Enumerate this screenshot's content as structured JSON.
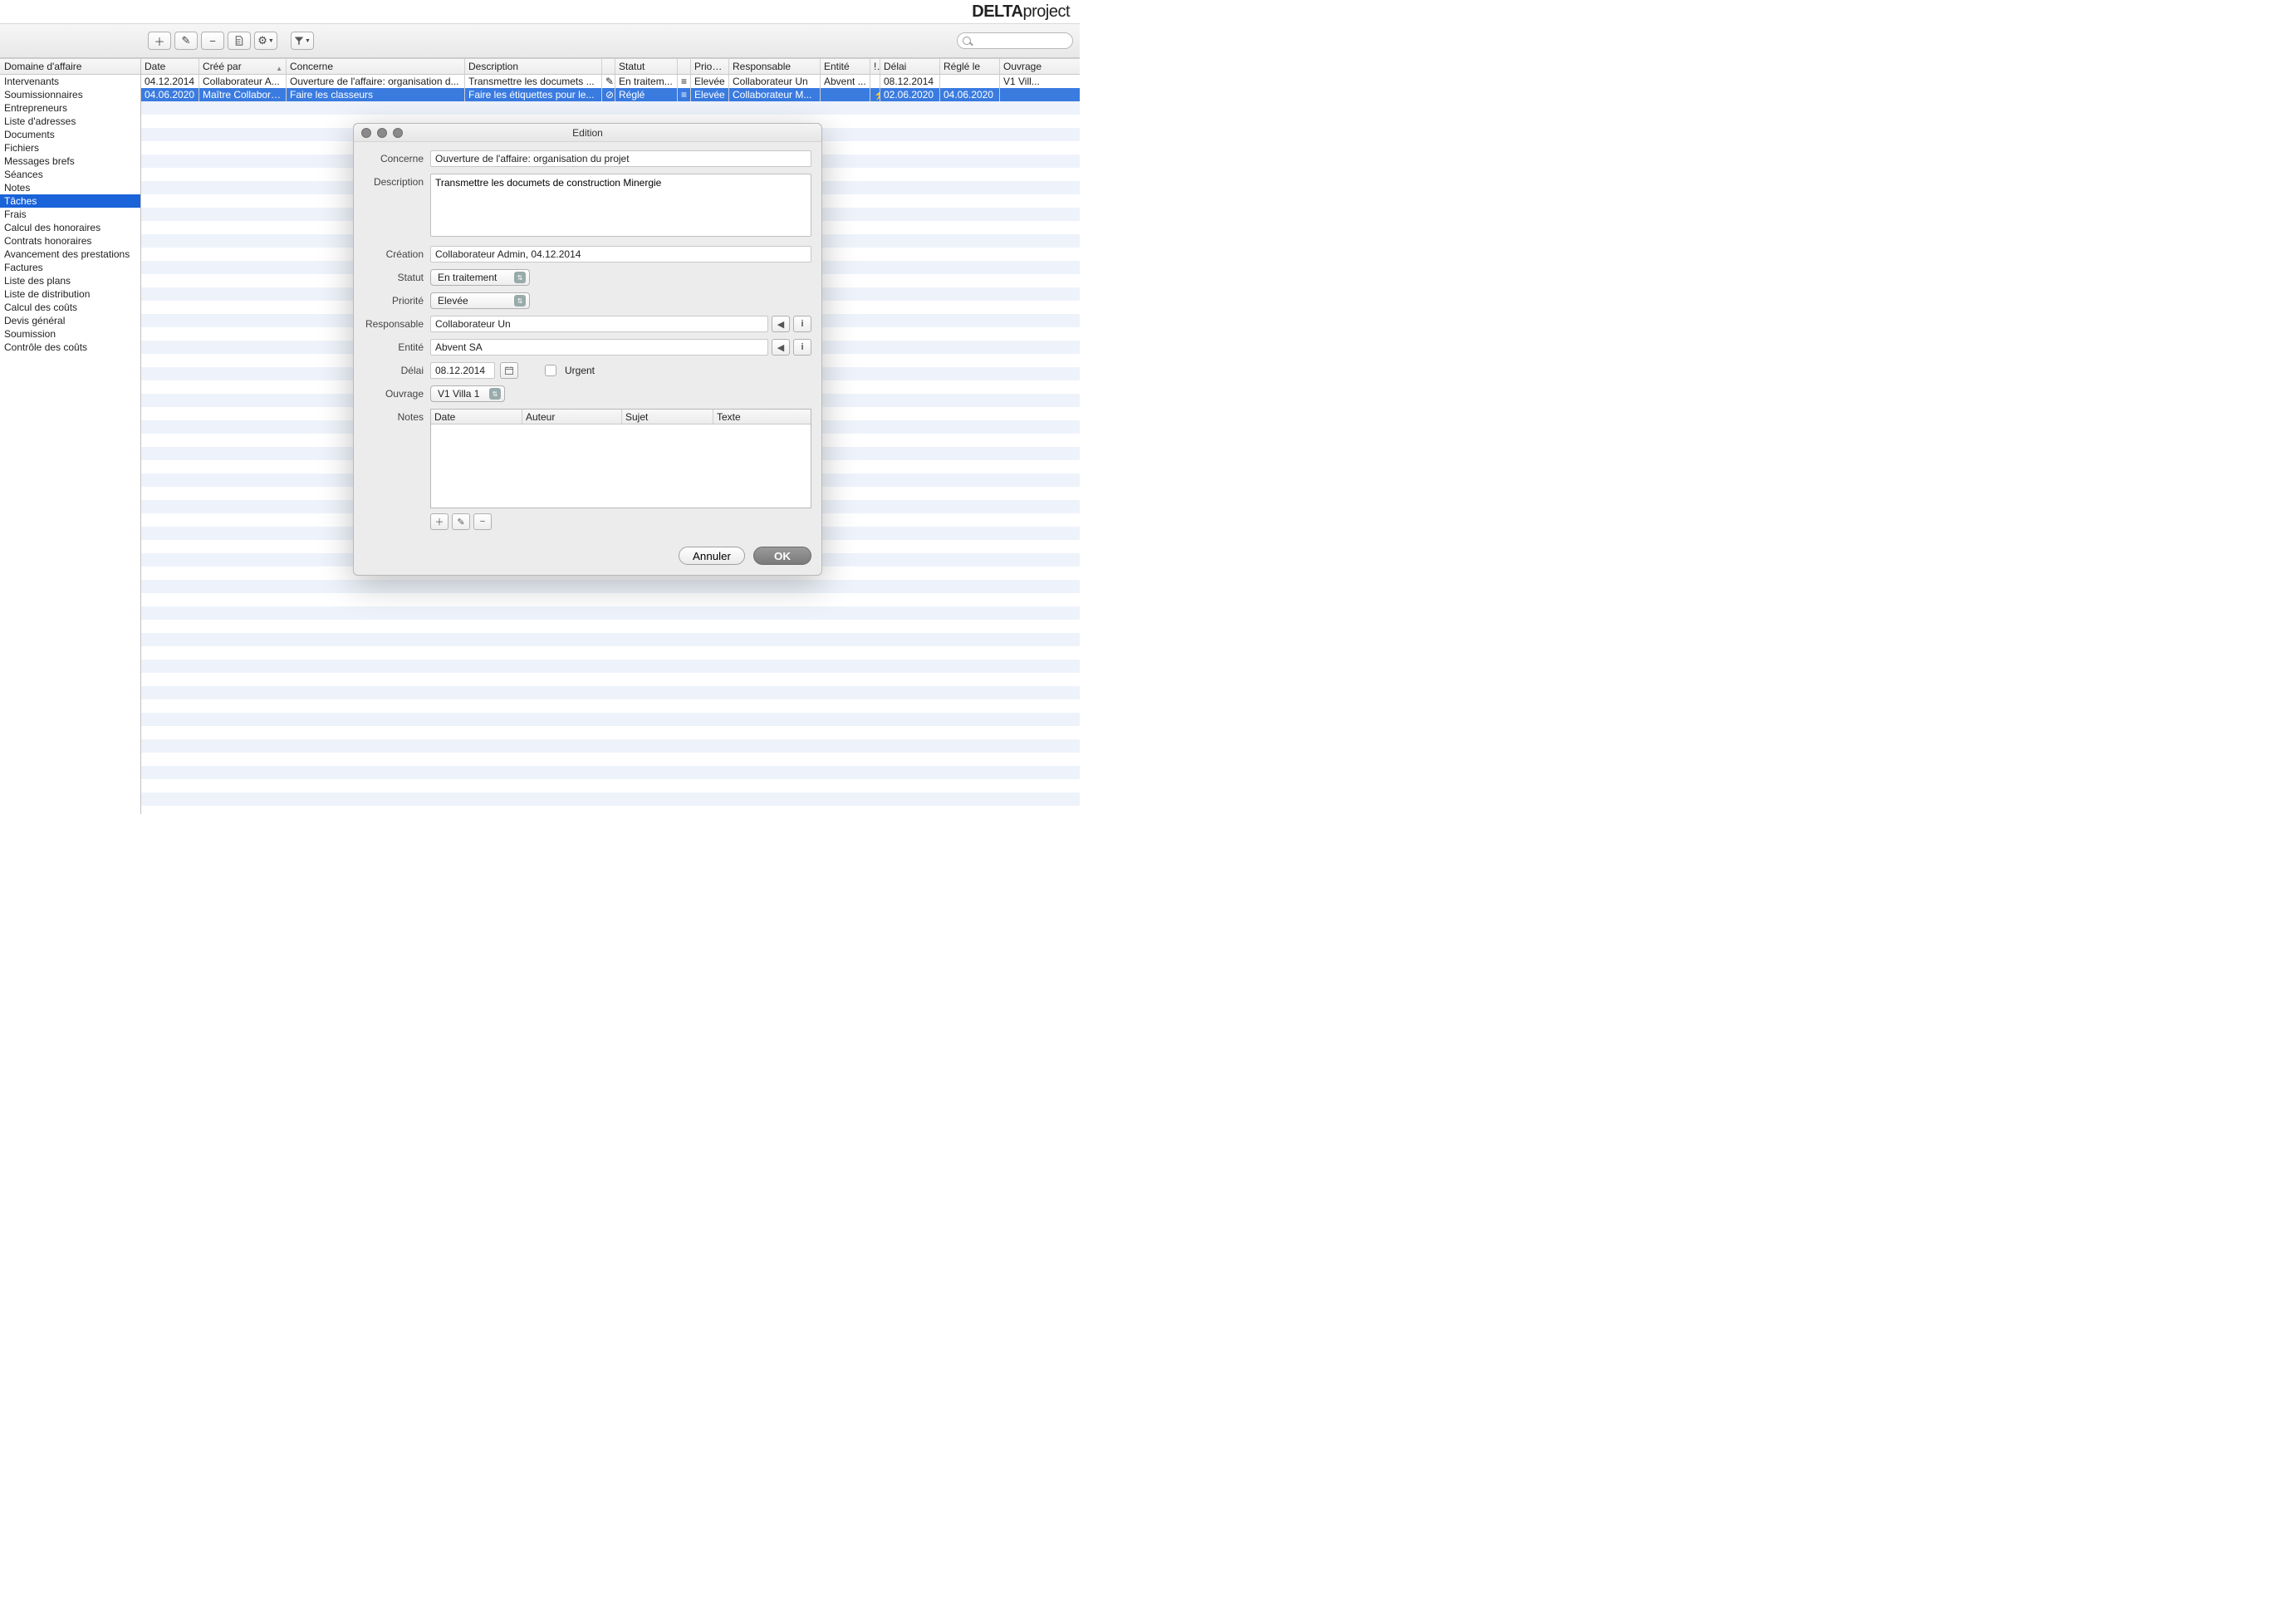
{
  "app": {
    "logo_bold": "DELTA",
    "logo_light": "project"
  },
  "toolbar": {
    "search_placeholder": ""
  },
  "sidebar": {
    "header": "Domaine d'affaire",
    "items": [
      "Intervenants",
      "Soumissionnaires",
      "Entrepreneurs",
      "Liste d'adresses",
      "Documents",
      "Fichiers",
      "Messages brefs",
      "Séances",
      "Notes",
      "Tâches",
      "Frais",
      "Calcul des honoraires",
      "Contrats honoraires",
      "Avancement des prestations",
      "Factures",
      "Liste des plans",
      "Liste de distribution",
      "Calcul des coûts",
      "Devis général",
      "Soumission",
      "Contrôle des coûts"
    ],
    "selected_index": 9
  },
  "columns": {
    "date": "Date",
    "cree_par": "Créé par",
    "concerne": "Concerne",
    "description": "Description",
    "statut": "Statut",
    "priorite": "Priorité",
    "responsable": "Responsable",
    "entite": "Entité",
    "bang": "!",
    "delai": "Délai",
    "regle_le": "Réglé le",
    "ouvrage": "Ouvrage"
  },
  "rows": [
    {
      "date": "04.12.2014",
      "cree_par": "Collaborateur A...",
      "concerne": "Ouverture de l'affaire: organisation d...",
      "description": "Transmettre les documets ...",
      "desc_icon": "✎",
      "statut": "En traitem...",
      "statut_icon": "≡",
      "priorite": "Elevée",
      "responsable": "Collaborateur Un",
      "entite": "Abvent ...",
      "bang": "",
      "delai": "08.12.2014",
      "regle_le": "",
      "ouvrage": "V1 Vill..."
    },
    {
      "date": "04.06.2020",
      "cree_par": "Maître Collabora...",
      "concerne": "Faire les classeurs",
      "description": "Faire les étiquettes pour le...",
      "desc_icon": "⊘",
      "statut": "Réglé",
      "statut_icon": "≡",
      "priorite": "Elevée",
      "responsable": "Collaborateur M...",
      "entite": "",
      "bang": "⚡",
      "delai": "02.06.2020",
      "regle_le": "04.06.2020",
      "ouvrage": ""
    }
  ],
  "dialog": {
    "title": "Edition",
    "labels": {
      "concerne": "Concerne",
      "description": "Description",
      "creation": "Création",
      "statut": "Statut",
      "priorite": "Priorité",
      "responsable": "Responsable",
      "entite": "Entité",
      "delai": "Délai",
      "urgent": "Urgent",
      "ouvrage": "Ouvrage",
      "notes": "Notes"
    },
    "values": {
      "concerne": "Ouverture de l'affaire: organisation du projet",
      "description": "Transmettre les documets de construction Minergie",
      "creation": "Collaborateur Admin, 04.12.2014",
      "statut": "En traitement",
      "priorite": "Elevée",
      "responsable": "Collaborateur Un",
      "entite": "Abvent SA",
      "delai": "08.12.2014",
      "ouvrage": "V1 Villa 1"
    },
    "notes_columns": {
      "date": "Date",
      "auteur": "Auteur",
      "sujet": "Sujet",
      "texte": "Texte"
    },
    "buttons": {
      "annuler": "Annuler",
      "ok": "OK"
    }
  }
}
